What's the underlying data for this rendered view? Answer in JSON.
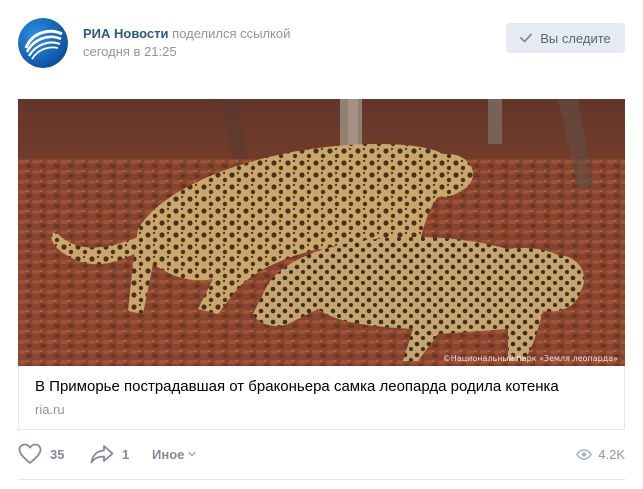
{
  "header": {
    "author_name": "РИА Новости",
    "author_action": "поделился ссылкой",
    "date": "сегодня в 21:25",
    "follow_label": "Вы следите",
    "avatar_icon": "ria-novosti-logo-icon",
    "check_icon": "check-icon"
  },
  "media": {
    "image_description_icon": "leopard-photo",
    "watermark": "©Национальный парк «Земля леопарда»"
  },
  "link": {
    "title": "В Приморье пострадавшая от браконьера самка леопарда родила котенка",
    "domain": "ria.ru"
  },
  "actions": {
    "likes": "35",
    "shares": "1",
    "more_label": "Иное",
    "views": "4.2K",
    "like_icon": "heart-icon",
    "share_icon": "share-arrow-icon",
    "more_icon": "chevron-down-icon",
    "views_icon": "eye-icon"
  },
  "colors": {
    "link_blue": "#2a5885",
    "muted_gray": "#939393",
    "action_gray": "#828a99",
    "button_bg": "#e5ebf1",
    "border": "#e7e8ec"
  }
}
